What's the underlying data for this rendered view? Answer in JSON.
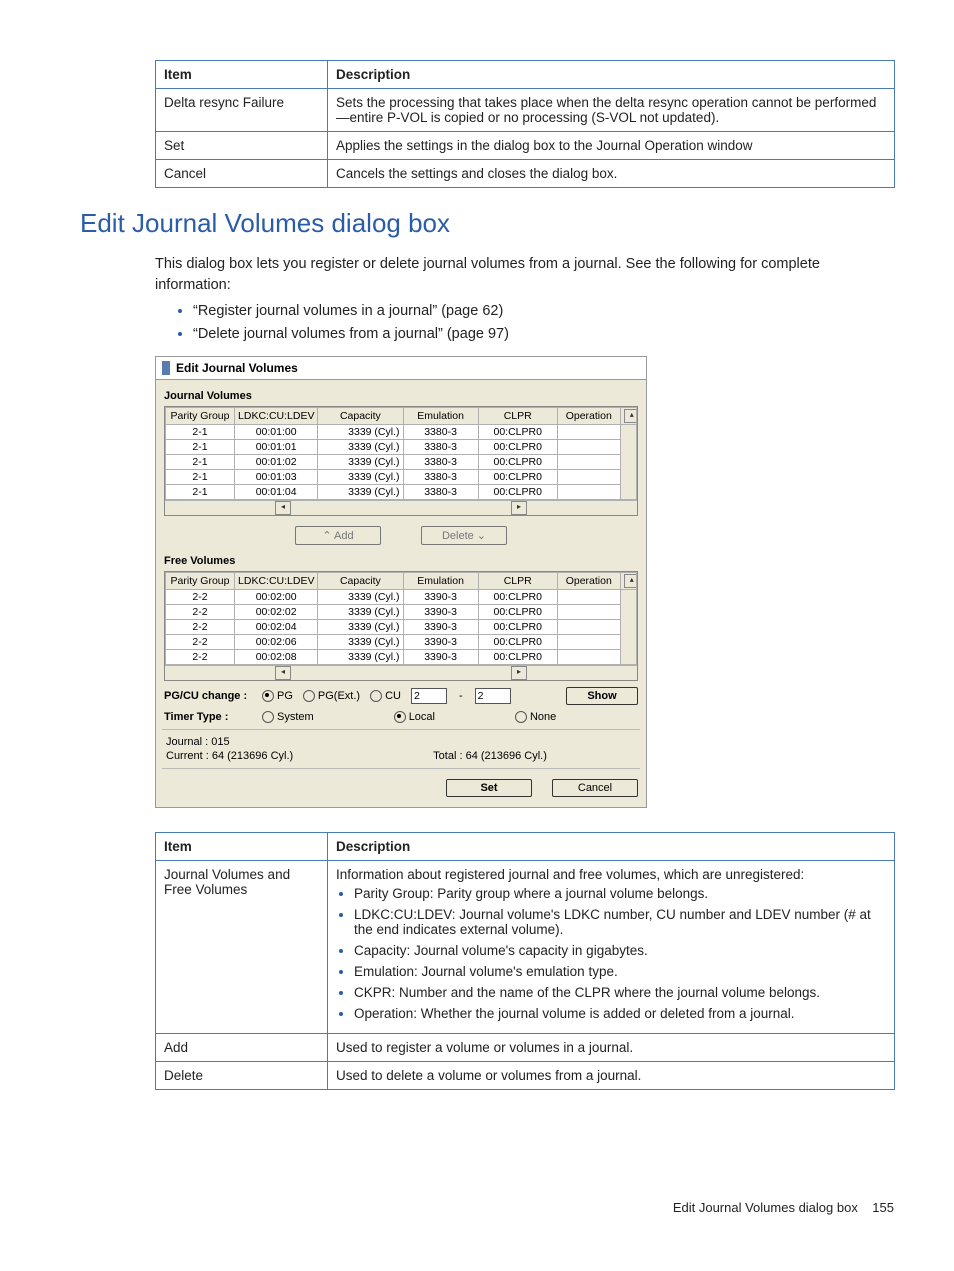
{
  "tables": {
    "upper": {
      "head_item": "Item",
      "head_desc": "Description",
      "rows": [
        {
          "item": "Delta resync Failure",
          "desc": "Sets the processing that takes place when the delta resync operation cannot be performed—entire P-VOL is copied or no processing (S-VOL not updated)."
        },
        {
          "item": "Set",
          "desc": "Applies the settings in the dialog box to the Journal Operation window"
        },
        {
          "item": "Cancel",
          "desc": "Cancels the settings and closes the dialog box."
        }
      ]
    },
    "lower": {
      "head_item": "Item",
      "head_desc": "Description",
      "rows": [
        {
          "item": "Journal Volumes and Free Volumes",
          "desc_intro": "Information about registered journal and free volumes, which are unregistered:",
          "bullets": [
            "Parity Group: Parity group where a journal volume belongs.",
            "LDKC:CU:LDEV: Journal volume's LDKC number, CU number and LDEV number (# at the end indicates external volume).",
            "Capacity: Journal volume's capacity in gigabytes.",
            "Emulation: Journal volume's emulation type.",
            "CKPR: Number and the name of the CLPR where the journal volume belongs.",
            "Operation: Whether the journal volume is added or deleted from a journal."
          ]
        },
        {
          "item": "Add",
          "desc": "Used to register a volume or volumes in a journal."
        },
        {
          "item": "Delete",
          "desc": "Used to delete a volume or volumes from a journal."
        }
      ]
    }
  },
  "section": {
    "title": "Edit Journal Volumes dialog box",
    "intro": "This dialog box lets you register or delete journal volumes from a journal. See the following for complete information:",
    "links": [
      "“Register journal volumes in a journal” (page 62)",
      "“Delete journal volumes from a journal” (page 97)"
    ]
  },
  "dialog": {
    "title": "Edit Journal Volumes",
    "jv_label": "Journal Volumes",
    "fv_label": "Free Volumes",
    "grid_headers": {
      "pg": "Parity Group",
      "ldk": "LDKC:CU:LDEV",
      "cap": "Capacity",
      "emu": "Emulation",
      "clpr": "CLPR",
      "op": "Operation"
    },
    "jv_rows": [
      {
        "pg": "2-1",
        "ldk": "00:01:00",
        "cap": "3339 (Cyl.)",
        "emu": "3380-3",
        "clpr": "00:CLPR0",
        "op": ""
      },
      {
        "pg": "2-1",
        "ldk": "00:01:01",
        "cap": "3339 (Cyl.)",
        "emu": "3380-3",
        "clpr": "00:CLPR0",
        "op": ""
      },
      {
        "pg": "2-1",
        "ldk": "00:01:02",
        "cap": "3339 (Cyl.)",
        "emu": "3380-3",
        "clpr": "00:CLPR0",
        "op": ""
      },
      {
        "pg": "2-1",
        "ldk": "00:01:03",
        "cap": "3339 (Cyl.)",
        "emu": "3380-3",
        "clpr": "00:CLPR0",
        "op": ""
      },
      {
        "pg": "2-1",
        "ldk": "00:01:04",
        "cap": "3339 (Cyl.)",
        "emu": "3380-3",
        "clpr": "00:CLPR0",
        "op": ""
      }
    ],
    "fv_rows": [
      {
        "pg": "2-2",
        "ldk": "00:02:00",
        "cap": "3339 (Cyl.)",
        "emu": "3390-3",
        "clpr": "00:CLPR0",
        "op": ""
      },
      {
        "pg": "2-2",
        "ldk": "00:02:02",
        "cap": "3339 (Cyl.)",
        "emu": "3390-3",
        "clpr": "00:CLPR0",
        "op": ""
      },
      {
        "pg": "2-2",
        "ldk": "00:02:04",
        "cap": "3339 (Cyl.)",
        "emu": "3390-3",
        "clpr": "00:CLPR0",
        "op": ""
      },
      {
        "pg": "2-2",
        "ldk": "00:02:06",
        "cap": "3339 (Cyl.)",
        "emu": "3390-3",
        "clpr": "00:CLPR0",
        "op": ""
      },
      {
        "pg": "2-2",
        "ldk": "00:02:08",
        "cap": "3339 (Cyl.)",
        "emu": "3390-3",
        "clpr": "00:CLPR0",
        "op": ""
      }
    ],
    "btn_add": "⌃ Add",
    "btn_delete": "Delete ⌄",
    "pgcu_label": "PG/CU change :",
    "pgcu_opts": {
      "pg": "PG",
      "pgext": "PG(Ext.)",
      "cu": "CU"
    },
    "cu_val1": "2",
    "cu_val2": "2",
    "btn_show": "Show",
    "timer_label": "Timer Type :",
    "timer_opts": {
      "system": "System",
      "local": "Local",
      "none": "None"
    },
    "journal_line": "Journal : 015",
    "current_line": "Current : 64 (213696 Cyl.)",
    "total_line": "Total : 64 (213696 Cyl.)",
    "btn_set": "Set",
    "btn_cancel": "Cancel"
  },
  "footer": {
    "text": "Edit Journal Volumes dialog box",
    "page": "155"
  }
}
